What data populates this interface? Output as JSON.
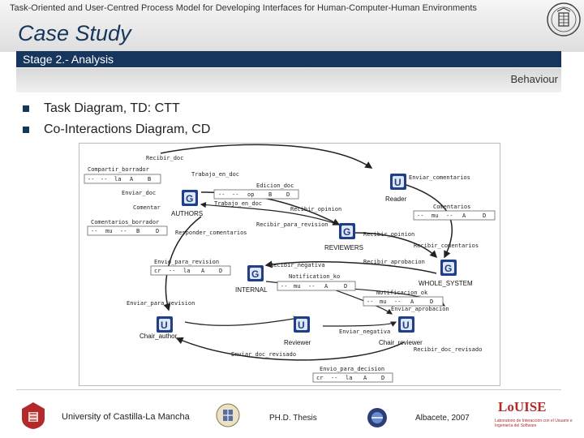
{
  "header": {
    "title": "Task-Oriented and User-Centred Process Model for Developing Interfaces for Human-Computer-Human Environments",
    "case_title": "Case Study"
  },
  "stage": {
    "label": "Stage 2.- Analysis"
  },
  "section": {
    "label": "Behaviour"
  },
  "bullets": [
    "Task Diagram, TD: CTT",
    "Co-Interactions Diagram, CD"
  ],
  "diagram": {
    "roles": {
      "authors": "AUTHORS",
      "reader": "Reader",
      "reviewers": "REVIEWERS",
      "whole_system": "WHOLE_SYSTEM",
      "internal": "INTERNAL",
      "chair_author": "Chair_author",
      "reviewer": "Reviewer",
      "chair_reviewer": "Chair_reviewer"
    },
    "messages": {
      "recibir_doc": "Recibir_doc",
      "compartir_borrador": "Compartir_borrador",
      "trabajo_en_doc": "Trabajo_en_doc",
      "edicion_doc": "Edicion_doc",
      "trabajo_en_doc2": "Trabajo_en_doc",
      "enviar_doc": "Enviar_doc",
      "enviar_comentarios": "Enviar_comentarios",
      "comentar": "Comentar",
      "recibir_opinion": "Recibir_opinion",
      "comentarios": "Comentarios",
      "comentarios_borrador": "Comentarios_borrador",
      "recibir_para_revision": "Recibir_para_revision",
      "recibir_opinion2": "Recibir_opinion",
      "responder_comentarios": "Responder_comentarios",
      "recibir_comentarios": "Recibir_comentarios",
      "envio_para_revision": "Envio_para_revision",
      "recibir_negativa": "Recibir_negativa",
      "recibir_aprobacion": "Recibir_aprobacion",
      "notification_ko": "Notification_ko",
      "notificacion_ok": "Notificacion_ok",
      "enviar_aprobacion": "Enviar_aprobacion",
      "enviar_para_revision": "Enviar_para_revision",
      "enviar_negativa": "Enviar_negativa",
      "recibir_doc_revisado": "Recibir_doc_revisado",
      "enviar_doc_revisado": "Enviar_doc_revisado",
      "envio_para_decision": "Envio_para_decision"
    },
    "tables": {
      "compartir": [
        "--",
        "--",
        "la",
        "A",
        "B"
      ],
      "edicion": [
        "--",
        "--",
        "op",
        "B",
        "D"
      ],
      "comentarios": [
        "--",
        "mu",
        "--",
        "A",
        "D"
      ],
      "comentarios_borrador": [
        "--",
        "mu",
        "--",
        "B",
        "D"
      ],
      "envio_revision": [
        "cr",
        "--",
        "la",
        "A",
        "D"
      ],
      "notification_ko": [
        "--",
        "mu",
        "--",
        "A",
        "D"
      ],
      "notificacion_ok": [
        "--",
        "mu",
        "--",
        "A",
        "D"
      ],
      "envio_decision": [
        "cr",
        "--",
        "la",
        "A",
        "D"
      ]
    }
  },
  "footer": {
    "university": "University of Castilla-La Mancha",
    "thesis": "PH.D. Thesis",
    "place_date": "Albacete, 2007",
    "lab": "LoUISE",
    "lab_caption": "Laboratorio de Interacción con el Usuario e Ingeniería del Software"
  }
}
